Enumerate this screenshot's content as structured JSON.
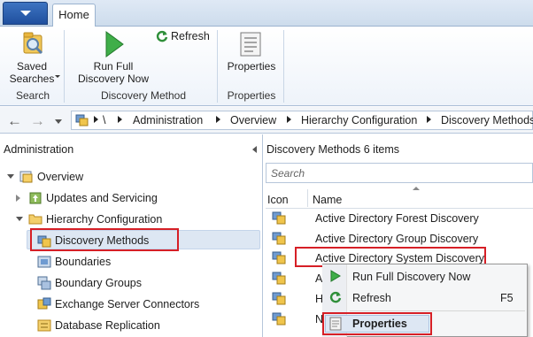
{
  "ribbon": {
    "tabs": [
      {
        "label": "Home"
      }
    ],
    "buttons": {
      "saved_searches": "Saved\nSearches",
      "refresh": "Refresh",
      "run_full_discovery": "Run Full\nDiscovery Now",
      "properties": "Properties"
    },
    "groups": {
      "search": "Search",
      "discovery_method": "Discovery Method",
      "properties": "Properties"
    }
  },
  "address_bar": {
    "root": "\\",
    "crumbs": [
      "Administration",
      "Overview",
      "Hierarchy Configuration",
      "Discovery Methods"
    ]
  },
  "left_pane": {
    "title": "Administration",
    "tree": [
      {
        "label": "Overview"
      },
      {
        "label": "Updates and Servicing"
      },
      {
        "label": "Hierarchy Configuration"
      },
      {
        "label": "Discovery Methods"
      },
      {
        "label": "Boundaries"
      },
      {
        "label": "Boundary Groups"
      },
      {
        "label": "Exchange Server Connectors"
      },
      {
        "label": "Database Replication"
      }
    ]
  },
  "right_pane": {
    "title": "Discovery Methods 6 items",
    "search_placeholder": "Search",
    "columns": {
      "icon": "Icon",
      "name": "Name"
    },
    "rows": [
      {
        "name": "Active Directory Forest Discovery"
      },
      {
        "name": "Active Directory Group Discovery"
      },
      {
        "name": "Active Directory System Discovery"
      },
      {
        "name": "A"
      },
      {
        "name": "H"
      },
      {
        "name": "N"
      }
    ]
  },
  "context_menu": {
    "items": [
      {
        "label": "Run Full Discovery Now",
        "shortcut": ""
      },
      {
        "label": "Refresh",
        "shortcut": "F5"
      },
      {
        "label": "Properties",
        "shortcut": ""
      }
    ]
  },
  "colors": {
    "accent": "#1f4f9e",
    "highlight_border": "#d61f26",
    "selection": "#dde7f3"
  }
}
